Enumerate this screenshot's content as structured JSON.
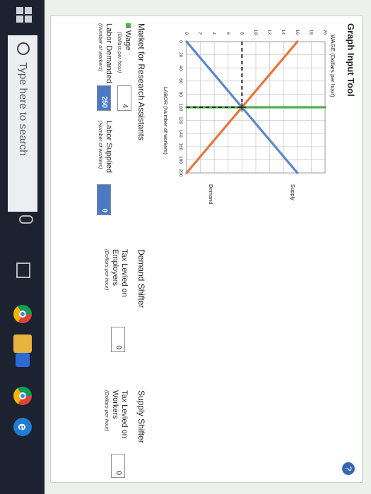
{
  "window": {
    "title": "Graph Input Tool",
    "help_label": "?"
  },
  "graph": {
    "ylabel": "WAGE (Dollars per hour)",
    "xlabel": "LABOR (Number of workers)",
    "y_ticks": [
      "0",
      "2",
      "4",
      "6",
      "8",
      "10",
      "12",
      "14",
      "16",
      "18",
      "20"
    ],
    "x_ticks": [
      "0",
      "20",
      "40",
      "60",
      "80",
      "100",
      "120",
      "140",
      "160",
      "180",
      "200"
    ],
    "supply_label": "Supply",
    "demand_label": "Demand",
    "colors": {
      "supply": "#5b86c8",
      "demand": "#e8733a",
      "green": "#4caf50",
      "dashed": "#222222"
    }
  },
  "chart_data": {
    "type": "line",
    "xlabel": "LABOR (Number of workers)",
    "ylabel": "WAGE (Dollars per hour)",
    "xlim": [
      0,
      200
    ],
    "ylim": [
      0,
      20
    ],
    "grid": true,
    "series": [
      {
        "name": "Supply",
        "x": [
          0,
          200
        ],
        "y": [
          0,
          16
        ]
      },
      {
        "name": "Demand",
        "x": [
          0,
          200
        ],
        "y": [
          16,
          0
        ]
      },
      {
        "x": [
          100,
          100
        ],
        "y": [
          0,
          20
        ]
      }
    ],
    "reference_lines": {
      "x": 100,
      "y": 8
    }
  },
  "market": {
    "title": "Market for Research Assistants",
    "wage_label": "Wage",
    "wage_unit": "(Dollars per hour)",
    "wage_value": "4",
    "labor_demanded_label": "Labor Demanded",
    "labor_demanded_unit": "(Number of workers)",
    "labor_demanded_value": "250",
    "labor_supplied_label": "Labor Supplied",
    "labor_supplied_unit": "(Number of workers)",
    "labor_supplied_value": "0"
  },
  "demand_shifter": {
    "title": "Demand Shifter",
    "tax_label": "Tax Levied on",
    "tax_label2": "Employers",
    "tax_unit": "(Dollars per hour)",
    "tax_value": "0"
  },
  "supply_shifter": {
    "title": "Supply Shifter",
    "tax_label": "Tax Levied on",
    "tax_label2": "Workers",
    "tax_unit": "(Dollars per hour)",
    "tax_value": "0"
  },
  "taskbar": {
    "search_placeholder": "Type here to search"
  }
}
